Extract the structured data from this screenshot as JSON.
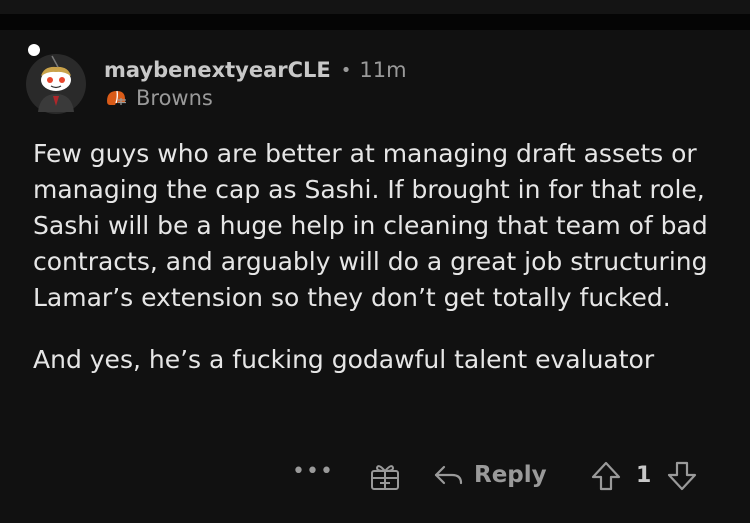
{
  "comment": {
    "username": "maybenextyearCLE",
    "separator": "•",
    "time": "11m",
    "flair": "Browns",
    "paragraphs": [
      "Few guys who are better at managing draft assets or managing the cap as Sashi. If brought in for that role, Sashi will be a huge help in cleaning that team of bad contracts, and arguably will do a great job structuring Lamar’s extension so they don’t get totally fucked.",
      "And yes, he’s a fucking godawful talent evaluator"
    ]
  },
  "actions": {
    "more_label": "•••",
    "reply_label": "Reply",
    "score": "1"
  },
  "icons": {
    "avatar": "snoo-avatar-icon",
    "flair": "browns-helmet-icon",
    "award": "award-gift-icon",
    "reply": "reply-arrow-icon",
    "upvote": "upvote-arrow-icon",
    "downvote": "downvote-arrow-icon"
  },
  "colors": {
    "background": "#111111",
    "text": "#e6e6e6",
    "muted": "#9a9a9a",
    "browns_orange": "#d95b18"
  }
}
